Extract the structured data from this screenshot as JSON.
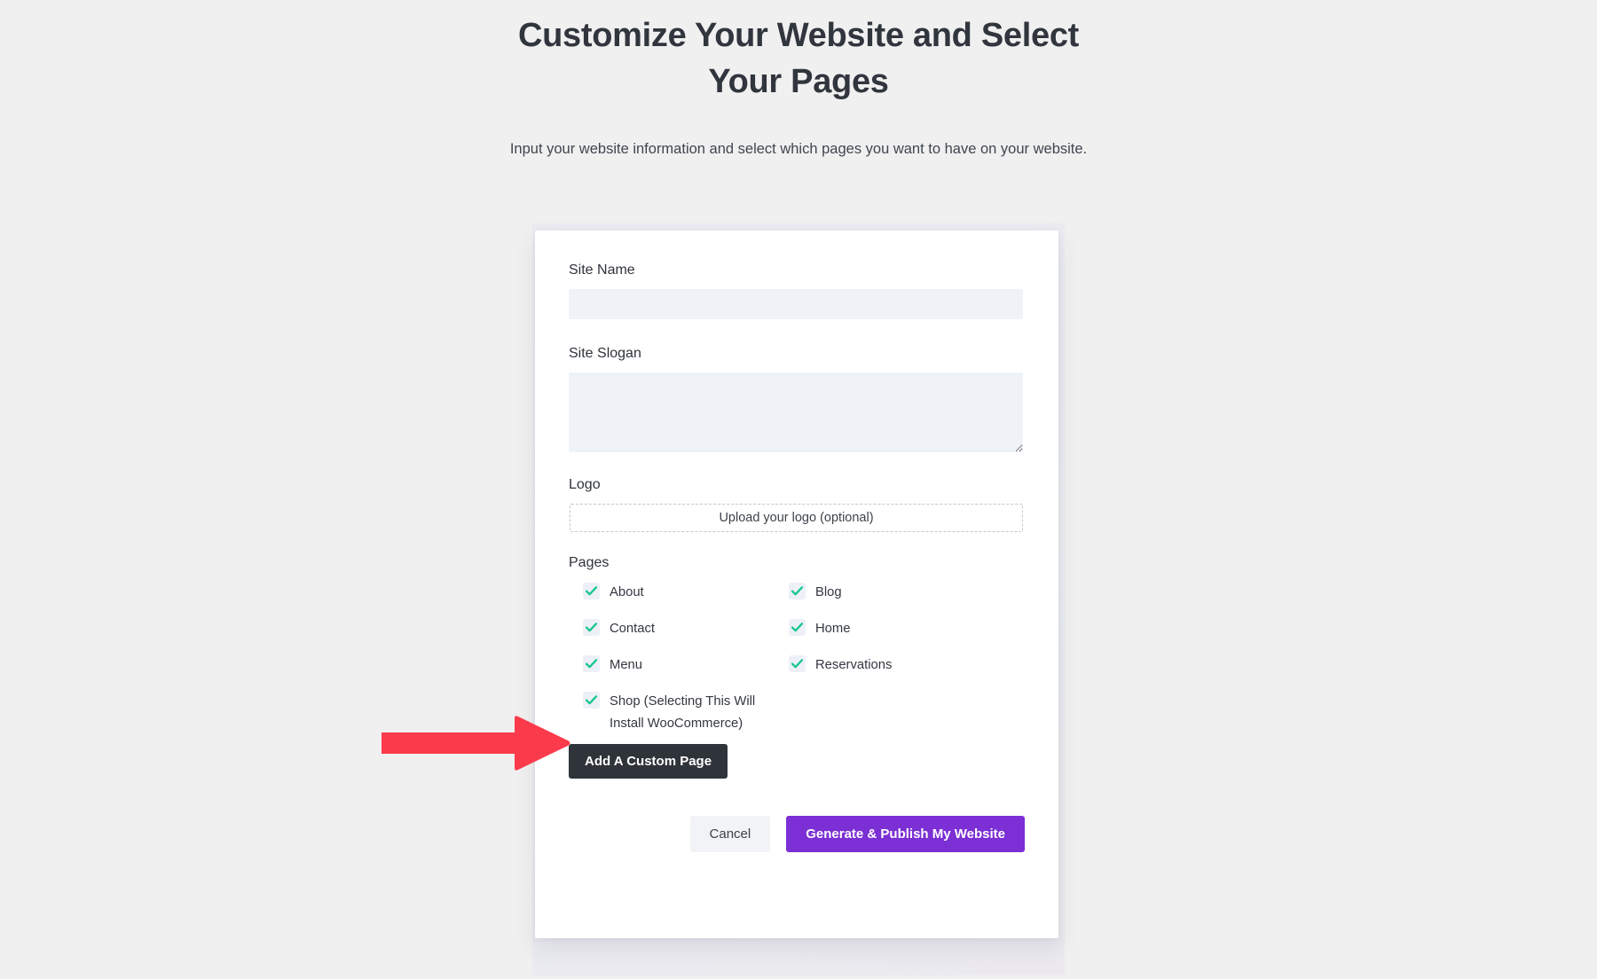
{
  "header": {
    "title": "Customize Your Website and Select Your Pages",
    "subtitle": "Input your website information and select which pages you want to have on your website."
  },
  "form": {
    "site_name": {
      "label": "Site Name",
      "value": "",
      "placeholder": ""
    },
    "site_slogan": {
      "label": "Site Slogan",
      "value": "",
      "placeholder": ""
    },
    "logo": {
      "label": "Logo",
      "upload_text": "Upload your logo (optional)"
    },
    "pages": {
      "label": "Pages",
      "items": [
        {
          "label": "About",
          "checked": true
        },
        {
          "label": "Blog",
          "checked": true
        },
        {
          "label": "Contact",
          "checked": true
        },
        {
          "label": "Home",
          "checked": true
        },
        {
          "label": "Menu",
          "checked": true
        },
        {
          "label": "Reservations",
          "checked": true
        },
        {
          "label": "Shop (Selecting This Will Install WooCommerce)",
          "checked": true
        }
      ],
      "add_custom_page_label": "Add A Custom Page"
    },
    "actions": {
      "cancel_label": "Cancel",
      "generate_label": "Generate & Publish My Website"
    }
  },
  "annotation": {
    "arrow_icon": "right-arrow-icon",
    "points_to": "Shop (Selecting This Will Install WooCommerce)"
  },
  "colors": {
    "page_background": "#f0f0f0",
    "card_background": "#ffffff",
    "input_background": "#eff3f7",
    "checkbox_background": "#eef0f8",
    "check_green": "#17c78f",
    "dark_button": "#2f333a",
    "accent_purple": "#7b2fd4",
    "cancel_grey": "#f2f3f6",
    "arrow_red": "#fb3b4b",
    "title_text": "#31353d"
  }
}
